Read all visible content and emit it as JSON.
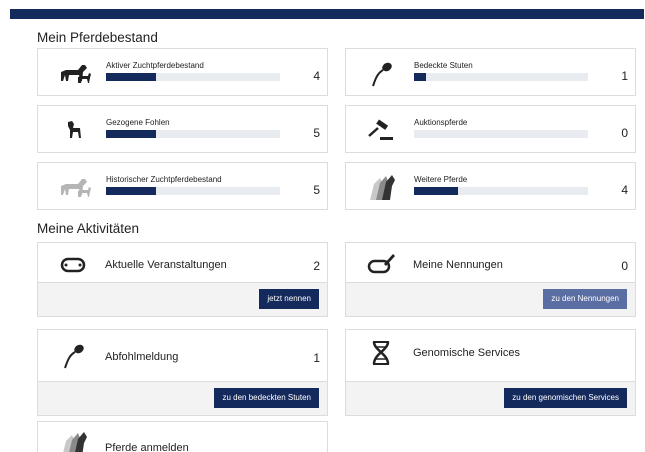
{
  "sections": {
    "horses_title": "Mein Pferdebestand",
    "activities_title": "Meine Aktivitäten"
  },
  "stats": [
    {
      "label": "Aktiver Zuchtpferdebestand",
      "count": "4",
      "fill": 0.29,
      "icon": "mare-foal-icon"
    },
    {
      "label": "Bedeckte Stuten",
      "count": "1",
      "fill": 0.07,
      "icon": "sperm-icon"
    },
    {
      "label": "Gezogene Fohlen",
      "count": "5",
      "fill": 0.29,
      "icon": "foal-icon"
    },
    {
      "label": "Auktionspferde",
      "count": "0",
      "fill": 0.0,
      "icon": "gavel-icon"
    },
    {
      "label": "Historischer Zuchtpferdebestand",
      "count": "5",
      "fill": 0.29,
      "icon": "historic-horses-icon"
    },
    {
      "label": "Weitere Pferde",
      "count": "4",
      "fill": 0.25,
      "icon": "horse-heads-icon"
    }
  ],
  "activities": [
    {
      "label": "Aktuelle Veranstaltungen",
      "count": "2",
      "button": "jetzt nennen",
      "icon": "racetrack-icon"
    },
    {
      "label": "Meine Nennungen",
      "count": "0",
      "button": "zu den Nennungen",
      "icon": "racetrack-pen-icon"
    },
    {
      "label": "Abfohlmeldung",
      "count": "1",
      "button": "zu den bedeckten Stuten",
      "icon": "sperm-icon"
    },
    {
      "label": "Genomische Services",
      "count": "",
      "button": "zu den genomischen Services",
      "icon": "dna-icon"
    },
    {
      "label": "Pferde anmelden",
      "icon": "horse-heads-icon"
    }
  ],
  "colors": {
    "primary": "#14295c",
    "primary_light": "#5b6ea3",
    "track": "#e8ebef"
  }
}
